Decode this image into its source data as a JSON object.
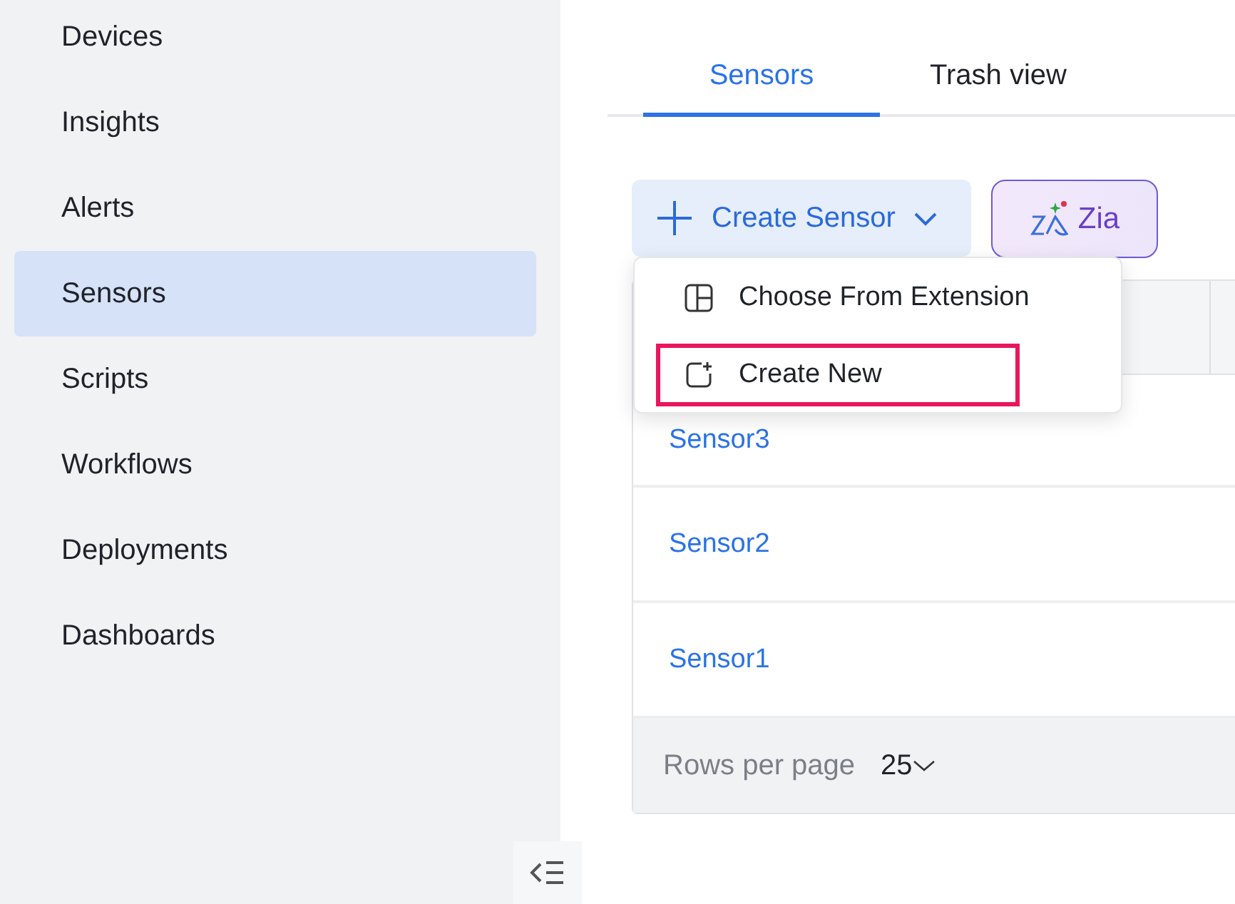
{
  "sidebar": {
    "items": [
      {
        "label": "Devices",
        "selected": false
      },
      {
        "label": "Insights",
        "selected": false
      },
      {
        "label": "Alerts",
        "selected": false
      },
      {
        "label": "Sensors",
        "selected": true
      },
      {
        "label": "Scripts",
        "selected": false
      },
      {
        "label": "Workflows",
        "selected": false
      },
      {
        "label": "Deployments",
        "selected": false
      },
      {
        "label": "Dashboards",
        "selected": false
      }
    ]
  },
  "tabs": [
    {
      "label": "Sensors",
      "selected": true
    },
    {
      "label": "Trash view",
      "selected": false
    }
  ],
  "toolbar": {
    "create_button": "Create Sensor",
    "zia_button": "Zia"
  },
  "dropdown_menu": {
    "items": [
      {
        "label": "Choose From Extension",
        "kind": "extension",
        "highlighted": false
      },
      {
        "label": "Create New",
        "kind": "new",
        "highlighted": true
      }
    ]
  },
  "table": {
    "rows": [
      {
        "name": "Sensor3"
      },
      {
        "name": "Sensor2"
      },
      {
        "name": "Sensor1"
      }
    ],
    "footer": {
      "label": "Rows per page",
      "value": "25"
    }
  }
}
